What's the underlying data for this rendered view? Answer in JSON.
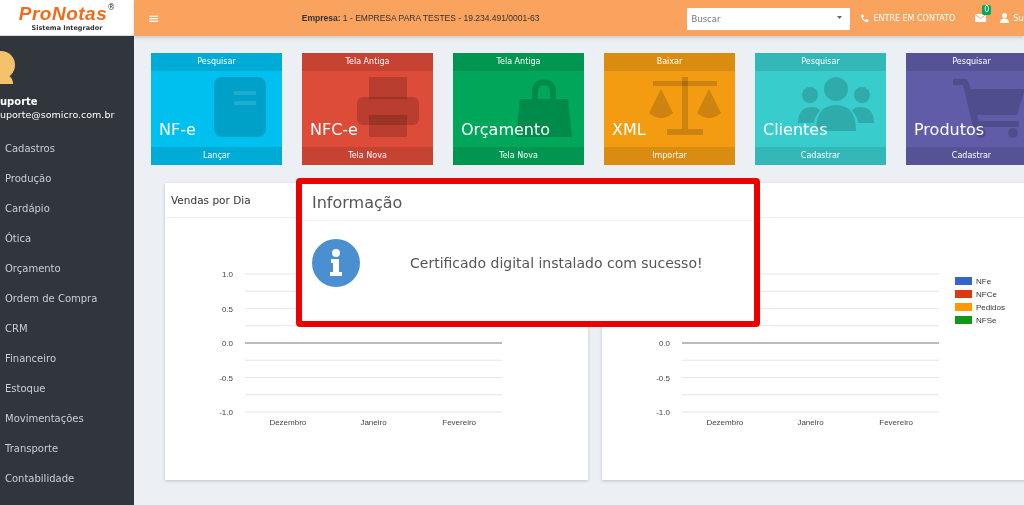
{
  "logo": {
    "name": "ProNotas",
    "mark": "®",
    "subtitle": "Sistema Integrador"
  },
  "topbar": {
    "menu_glyph": "≡",
    "company_label": "Empresa:",
    "company_value": "1 - EMPRESA PARA TESTES - 19.234.491/0001-63",
    "search": {
      "placeholder": "Buscar"
    },
    "contact": "ENTRE EM CONTATO",
    "mail_badge": "0",
    "user": "Su"
  },
  "sidebar": {
    "user_name": "uporte",
    "user_email": "uporte@somicro.com.br",
    "items": [
      {
        "label": "Cadastros"
      },
      {
        "label": "Produção"
      },
      {
        "label": "Cardápio"
      },
      {
        "label": "Ótica"
      },
      {
        "label": "Orçamento"
      },
      {
        "label": "Ordem de Compra"
      },
      {
        "label": "CRM"
      },
      {
        "label": "Financeiro"
      },
      {
        "label": "Estoque"
      },
      {
        "label": "Movimentações"
      },
      {
        "label": "Transporte"
      },
      {
        "label": "Contabilidade"
      }
    ]
  },
  "tiles": [
    {
      "top": "Pesquisar",
      "title": "NF-e",
      "bottom": "Lançar",
      "color": "#00c0ef"
    },
    {
      "top": "Tela Antiga",
      "title": "NFC-e",
      "bottom": "Tela Nova",
      "color": "#dd4b39"
    },
    {
      "top": "Tela Antiga",
      "title": "Orçamento",
      "bottom": "Tela Nova",
      "color": "#00a65a"
    },
    {
      "top": "Baixar",
      "title": "XML",
      "bottom": "Importar",
      "color": "#f39c12"
    },
    {
      "top": "Pesquisar",
      "title": "Clientes",
      "bottom": "Cadastrar",
      "color": "#39cccc"
    },
    {
      "top": "Pesquisar",
      "title": "Produtos",
      "bottom": "Cadastrar",
      "color": "#605ca8"
    }
  ],
  "charts": [
    {
      "title": "Vendas por Dia",
      "chart_data": {
        "type": "line",
        "categories": [
          "Dezembro",
          "Janeiro",
          "Fevereiro"
        ],
        "ylim": [
          -1,
          1
        ],
        "yticks": [
          {
            "value": 1,
            "label": "1.0"
          },
          {
            "value": 0.5,
            "label": "0.5"
          },
          {
            "value": 0,
            "label": "0.0"
          },
          {
            "value": -0.5,
            "label": "-0.5"
          },
          {
            "value": -1,
            "label": "-1.0"
          }
        ]
      }
    },
    {
      "chart_data": {
        "type": "line",
        "categories": [
          "Dezembro",
          "Janeiro",
          "Fevereiro"
        ],
        "ylim": [
          -1,
          1
        ],
        "yticks": [
          {
            "value": 0,
            "label": "0.0"
          },
          {
            "value": -0.5,
            "label": "-0.5"
          },
          {
            "value": -1,
            "label": "-1.0"
          }
        ],
        "series": [
          {
            "name": "NFe",
            "color": "#3366cc",
            "values": [
              null,
              null,
              null
            ]
          },
          {
            "name": "NFCe",
            "color": "#dc3912",
            "values": [
              null,
              null,
              null
            ]
          },
          {
            "name": "Pedidos",
            "color": "#ff9900",
            "values": [
              null,
              null,
              null
            ]
          },
          {
            "name": "NFSe",
            "color": "#109618",
            "values": [
              null,
              null,
              null
            ]
          }
        ]
      }
    }
  ],
  "dialog": {
    "title": "Informação",
    "message": "Certificado digital instalado com sucesso!"
  }
}
